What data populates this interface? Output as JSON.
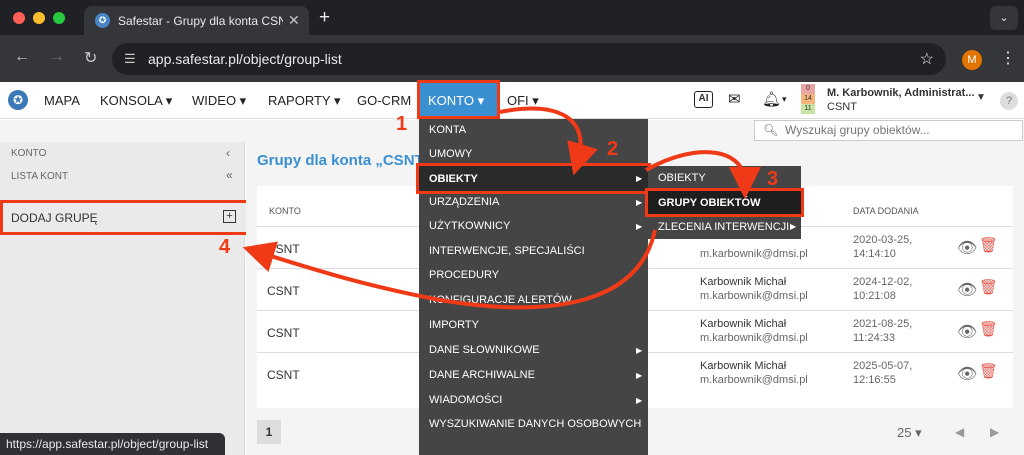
{
  "browser": {
    "tab_title": "Safestar - Grupy dla konta CSNT",
    "tab_close": "✕",
    "new_tab": "+",
    "url": "app.safestar.pl/object/group-list",
    "profile_initial": "M",
    "status_url": "https://app.safestar.pl/object/group-list"
  },
  "nav": {
    "items": [
      "MAPA",
      "KONSOLA ▾",
      "WIDEO ▾",
      "RAPORTY ▾",
      "GO-CRM",
      "KONTO ▾",
      "OFI ▾"
    ]
  },
  "user": {
    "name": "M. Karbownik, Administrat...",
    "org": "CSNT",
    "badges": [
      "0",
      "14",
      "11"
    ],
    "badge_colors": [
      "#e9a5a5",
      "#f3b57a",
      "#c7e3a5"
    ]
  },
  "search": {
    "placeholder": "Wyszukaj grupy obiektów..."
  },
  "sidebar": {
    "header1": "KONTO",
    "header2": "LISTA KONT",
    "chev1": "‹",
    "chev2": "«",
    "add_group": "DODAJ GRUPĘ"
  },
  "main": {
    "title": "Grupy dla konta „CSNT\""
  },
  "table": {
    "col_konto": "KONTO",
    "col_date": "DATA DODANIA",
    "rows": [
      {
        "konto": "CSNT",
        "name": "",
        "email": "m.karbownik@dmsi.pl",
        "date": "2020-03-25,",
        "time": "14:14:10"
      },
      {
        "konto": "CSNT",
        "name": "Karbownik Michał",
        "email": "m.karbownik@dmsi.pl",
        "date": "2024-12-02,",
        "time": "10:21:08"
      },
      {
        "konto": "CSNT",
        "name": "Karbownik Michał",
        "email": "m.karbownik@dmsi.pl",
        "date": "2021-08-25,",
        "time": "11:24:33"
      },
      {
        "konto": "CSNT",
        "name": "Karbownik Michał",
        "email": "m.karbownik@dmsi.pl",
        "date": "2025-05-07,",
        "time": "12:16:55"
      }
    ]
  },
  "pager": {
    "page": "1",
    "size": "25 ▾",
    "prev": "◀",
    "next": "▶"
  },
  "konto_menu": {
    "items": [
      "KONTA",
      "UMOWY",
      "OBIEKTY",
      "URZĄDZENIA",
      "UŻYTKOWNICY",
      "INTERWENCJE, SPECJALIŚCI",
      "PROCEDURY",
      "KONFIGURACJE ALERTÓW",
      "IMPORTY",
      "DANE SŁOWNIKOWE",
      "DANE ARCHIWALNE",
      "WIADOMOŚCI",
      "WYSZUKIWANIE DANYCH OSOBOWYCH"
    ]
  },
  "obiekty_menu": {
    "items": [
      "OBIEKTY",
      "GRUPY OBIEKTÓW",
      "ZLECENIA INTERWENCJI"
    ]
  },
  "annotations": {
    "n1": "1",
    "n2": "2",
    "n3": "3",
    "n4": "4",
    "color": "#f03a17"
  }
}
